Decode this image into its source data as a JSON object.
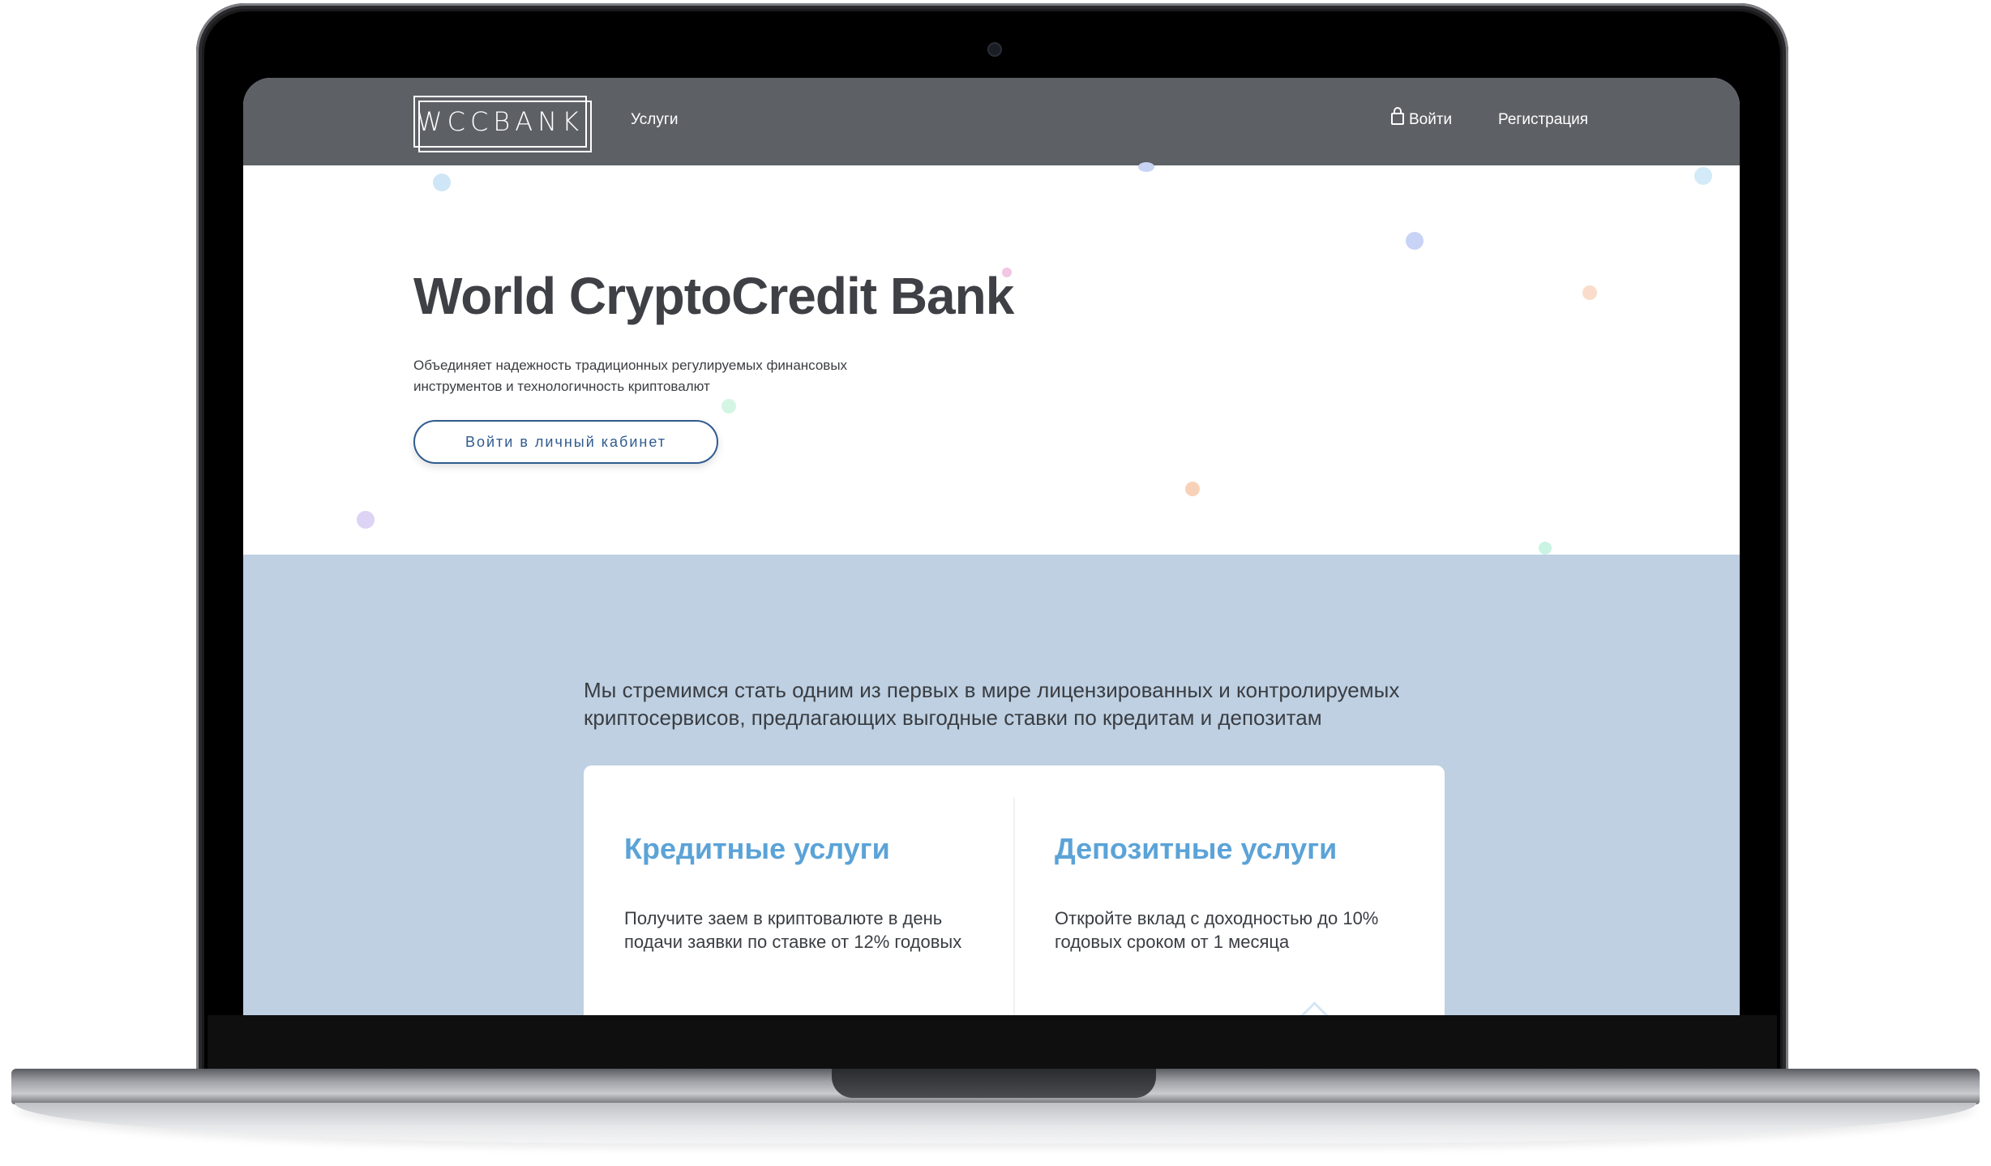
{
  "nav": {
    "logo": "WCCBANK",
    "services_link": "Услуги",
    "login_link": "Войти",
    "register_link": "Регистрация"
  },
  "hero": {
    "title": "World CryptoCredit Bank",
    "description": "Объединяет надежность традиционных регулируемых финансовых инструментов и технологичность криптовалют",
    "cta_button": "Войти в личный кабинет"
  },
  "mission": {
    "text": "Мы стремимся стать одним из первых в мире лицензированных и контролируемых криптосервисов, предлагающих выгодные ставки по кредитам и депозитам"
  },
  "services": [
    {
      "title": "Кредитные услуги",
      "text": "Получите заем в криптовалюте в день подачи заявки по ставке от 12% годовых"
    },
    {
      "title": "Депозитные услуги",
      "text": "Откройте вклад с доходностью до 10% годовых сроком от 1 месяца"
    }
  ],
  "colors": {
    "nav_bg": "#5d6166",
    "band_bg": "#bed0e2",
    "accent": "#5ba3d7",
    "button_border": "#2f5b8f"
  }
}
